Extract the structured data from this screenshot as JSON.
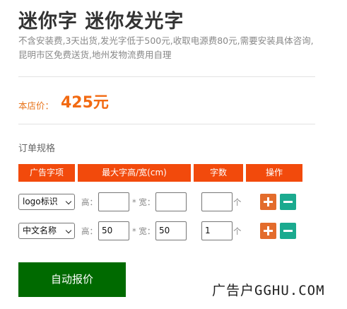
{
  "product": {
    "title": "迷你字 迷你发光字",
    "description": "不含安装费,3天出货,发光字低于500元,收取电源费80元,需要安装具体咨询,昆明市区免费送货,地州发物流费用自理"
  },
  "price": {
    "label": "本店价：",
    "value": "425元"
  },
  "order_spec": {
    "label": "订单规格",
    "headers": [
      "广告字项",
      "最大字高/宽(cm)",
      "字数",
      "操作"
    ],
    "field_labels": {
      "height": "高：",
      "width": "* 宽：",
      "unit": "个"
    },
    "rows": [
      {
        "type": "logo标识",
        "height": "",
        "width": "",
        "quantity": ""
      },
      {
        "type": "中文名称",
        "height": "50",
        "width": "50",
        "quantity": "1"
      }
    ]
  },
  "actions": {
    "quote_button": "自动报价"
  },
  "watermark": "广告户GGHU.COM",
  "colors": {
    "header_bg": "#f24a0c",
    "price": "#f26a12",
    "plus_button": "#e36c2c",
    "minus_button": "#1baa8f",
    "quote_button": "#006a00"
  }
}
